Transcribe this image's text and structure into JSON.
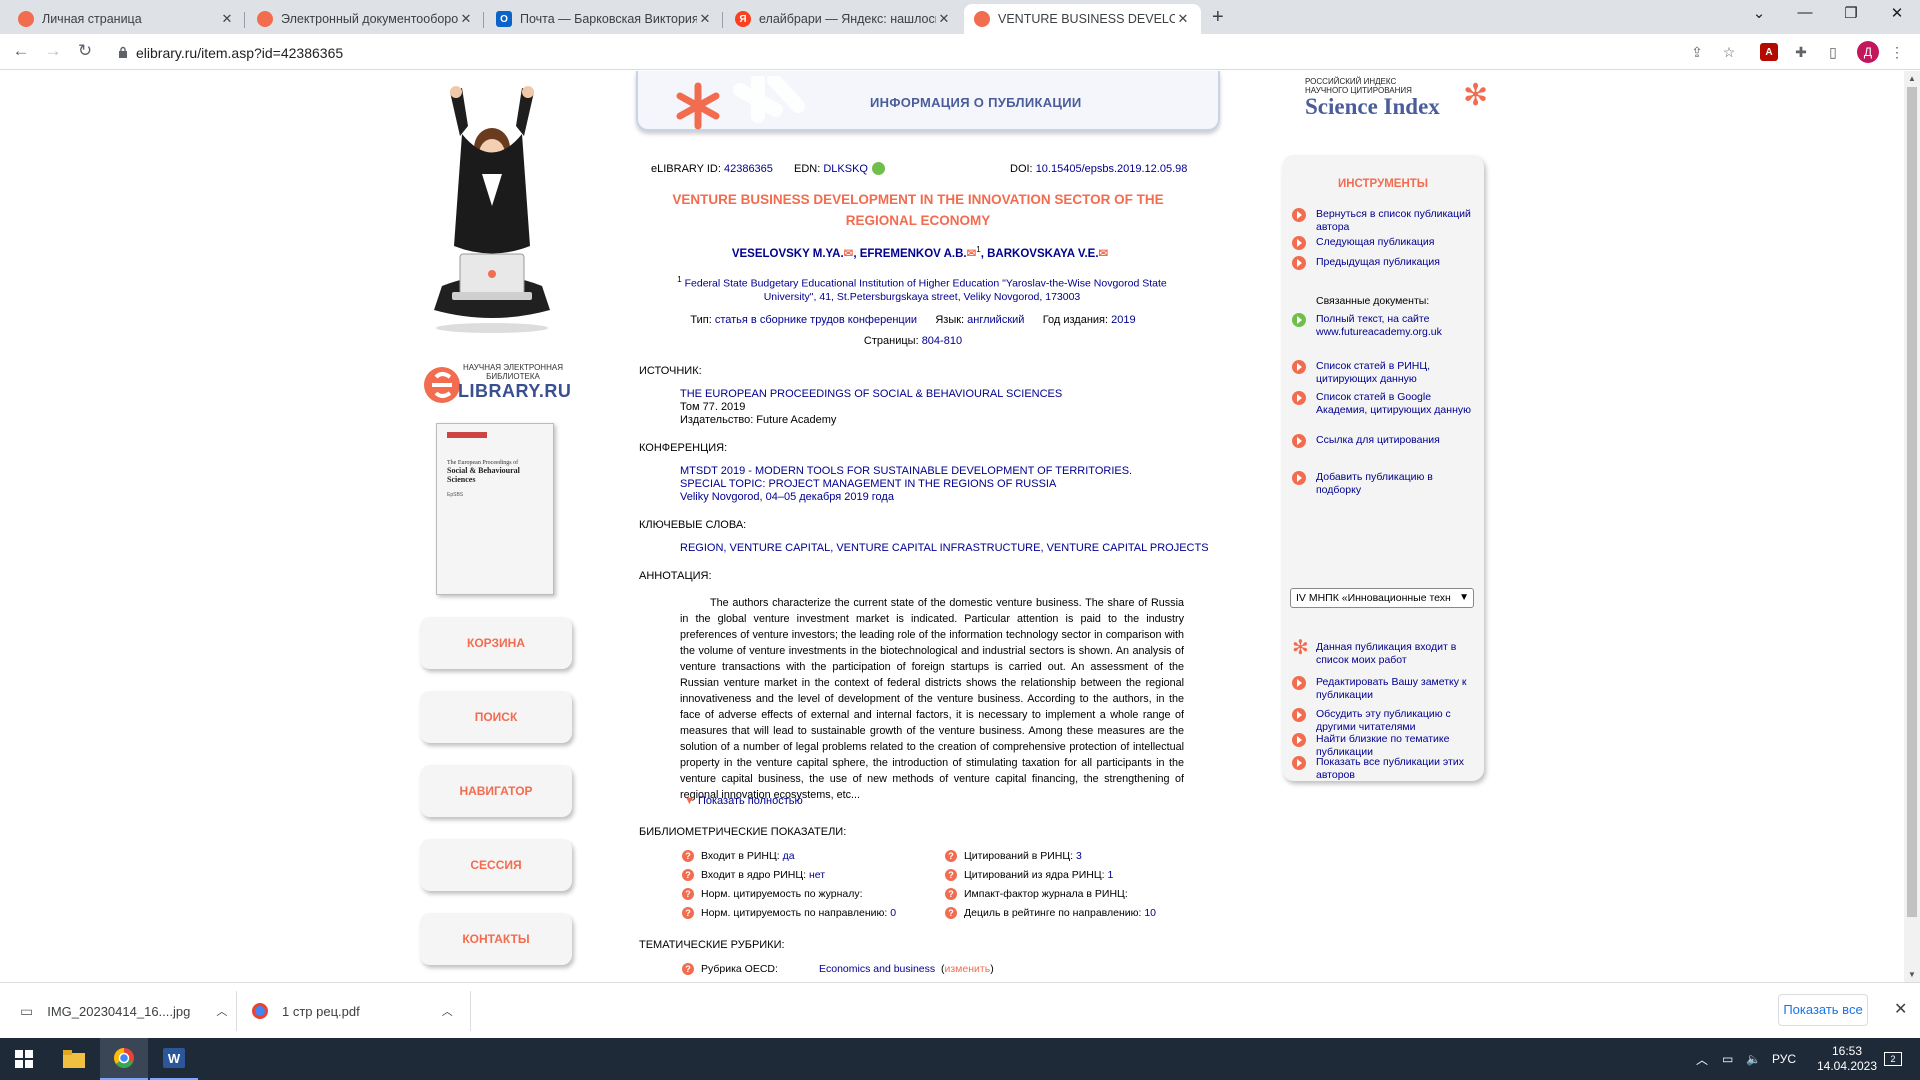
{
  "browser": {
    "tabs": [
      {
        "title": "Личная страница",
        "fav_color": "#f26c4f"
      },
      {
        "title": "Электронный документооборот",
        "fav_color": "#f26c4f"
      },
      {
        "title": "Почта — Барковская Виктория",
        "fav_color": "#0a64c8"
      },
      {
        "title": "елайбрари — Яндекс: нашлось",
        "fav_color": "#fc3f1d"
      },
      {
        "title": "VENTURE BUSINESS DEVELOPME",
        "fav_color": "#f26c4f"
      }
    ],
    "new_tab": "+",
    "url": "elibrary.ru/item.asp?id=42386365",
    "profile_initial": "Д"
  },
  "left": {
    "elib_logo_top": "НАУЧНАЯ ЭЛЕКТРОННАЯ",
    "elib_logo_mid": "БИБЛИОТЕКА",
    "elib_logo_main": "LIBRARY.RU",
    "cover": {
      "line1": "The European Proceedings of",
      "line2": "Social & Behavioural Sciences",
      "line3": "EpSBS"
    },
    "buttons": [
      "КОРЗИНА",
      "ПОИСК",
      "НАВИГАТОР",
      "СЕССИЯ",
      "КОНТАКТЫ"
    ]
  },
  "header": {
    "title": "ИНФОРМАЦИЯ О ПУБЛИКАЦИИ"
  },
  "ident": {
    "elib_label": "eLIBRARY ID:",
    "elib_id": "42386365",
    "edn_label": "EDN:",
    "edn": "DLKSKQ",
    "doi_label": "DOI:",
    "doi": "10.15405/epsbs.2019.12.05.98"
  },
  "article": {
    "title": "VENTURE BUSINESS DEVELOPMENT IN THE INNOVATION SECTOR OF THE REGIONAL ECONOMY",
    "author1": "VESELOVSKY M.YA.",
    "author2": "EFREMENKOV A.B.",
    "author2_sup": "1",
    "author3": "BARKOVSKAYA V.E.",
    "affil_sup": "1",
    "affiliation": "Federal State Budgetary Educational Institution of Higher Education \"Yaroslav-the-Wise Novgorod State University\", 41, St.Petersburgskaya street, Veliky Novgorod, 173003",
    "type_label": "Тип:",
    "type": "статья в сборнике трудов конференции",
    "lang_label": "Язык:",
    "lang": "английский",
    "year_label": "Год издания:",
    "year": "2019",
    "pages_label": "Страницы:",
    "pages": "804-810"
  },
  "source": {
    "label": "ИСТОЧНИК:",
    "journal": "THE EUROPEAN PROCEEDINGS OF SOCIAL & BEHAVIOURAL SCIENCES",
    "volume": "Том 77. 2019",
    "publisher": "Издательство: Future Academy"
  },
  "conference": {
    "label": "КОНФЕРЕНЦИЯ:",
    "name": "MTSDT 2019 - MODERN TOOLS FOR SUSTAINABLE DEVELOPMENT OF TERRITORIES. SPECIAL TOPIC: PROJECT MANAGEMENT IN THE REGIONS OF RUSSIA",
    "place": "Veliky Novgorod, 04–05 декабря 2019 года"
  },
  "keywords": {
    "label": "КЛЮЧЕВЫЕ СЛОВА:",
    "items": [
      "REGION",
      "VENTURE CAPITAL",
      "VENTURE CAPITAL INFRASTRUCTURE",
      "VENTURE CAPITAL PROJECTS"
    ]
  },
  "annotation": {
    "label": "АННОТАЦИЯ:",
    "text": "The authors characterize the current state of the domestic venture business. The share of Russia in the global venture investment market is indicated. Particular attention is paid to the industry preferences of venture investors; the leading role of the information technology sector in comparison with the volume of venture investments in the biotechnological and industrial sectors is shown. An analysis of venture transactions with the participation of foreign startups is carried out. An assessment of the Russian venture market in the context of federal districts shows the relationship between the regional innovativeness and the level of development of the venture business. According to the authors, in the face of adverse effects of external and internal factors, it is necessary to implement a whole range of measures that will lead to sustainable growth of the venture business. Among these measures are the solution of a number of legal problems related to the creation of comprehensive protection of intellectual property in the venture capital sphere, the introduction of stimulating taxation for all participants in the venture capital business, the use of new methods of venture capital financing, the strengthening of regional innovation ecosystems, etc...",
    "show_full": "Показать полностью"
  },
  "biblio": {
    "label": "БИБЛИОМЕТРИЧЕСКИЕ ПОКАЗАТЕЛИ:",
    "left": [
      {
        "label": "Входит в РИНЦ:",
        "value": "да"
      },
      {
        "label": "Входит в ядро РИНЦ:",
        "value": "нет"
      },
      {
        "label": "Норм. цитируемость по журналу:",
        "value": ""
      },
      {
        "label": "Норм. цитируемость по направлению:",
        "value": "0"
      }
    ],
    "right": [
      {
        "label": "Цитирований в РИНЦ:",
        "value": "3"
      },
      {
        "label": "Цитирований из ядра РИНЦ:",
        "value": "1"
      },
      {
        "label": "Импакт-фактор журнала в РИНЦ:",
        "value": ""
      },
      {
        "label": "Дециль в рейтинге по направлению:",
        "value": "10"
      }
    ]
  },
  "rubrics": {
    "label": "ТЕМАТИЧЕСКИЕ РУБРИКИ:",
    "oecd_label": "Рубрика OECD:",
    "oecd_value": "Economics and business",
    "change_open": "(",
    "change": "изменить",
    "change_close": ")"
  },
  "right": {
    "si_line1": "РОССИЙСКИЙ ИНДЕКС",
    "si_line2": "НАУЧНОГО ЦИТИРОВАНИЯ",
    "si_main": "Science Index",
    "tools_title": "ИНСТРУМЕНТЫ",
    "items": [
      "Вернуться в список публикаций автора",
      "Следующая публикация",
      "Предыдущая публикация",
      "Полный текст, на сайте www.futureacademy.org.uk",
      "Список статей в РИНЦ, цитирующих данную",
      "Список статей в Google Академия, цитирующих данную",
      "Ссылка для цитирования",
      "Добавить публикацию в подборку",
      "Данная публикация входит в список моих работ",
      "Редактировать Вашу заметку к публикации",
      "Обсудить эту публикацию с другими читателями",
      "Показать все публикации этих авторов",
      "Найти близкие по тематике публикации"
    ],
    "related_label": "Связанные документы:",
    "select_value": "IV МНПК «Инновационные техн"
  },
  "downloads": {
    "item1": "IMG_20230414_16....jpg",
    "item2": "1 стр рец.pdf",
    "show_all": "Показать все"
  },
  "taskbar": {
    "lang": "РУС",
    "time": "16:53",
    "date": "14.04.2023",
    "notif": "2"
  }
}
